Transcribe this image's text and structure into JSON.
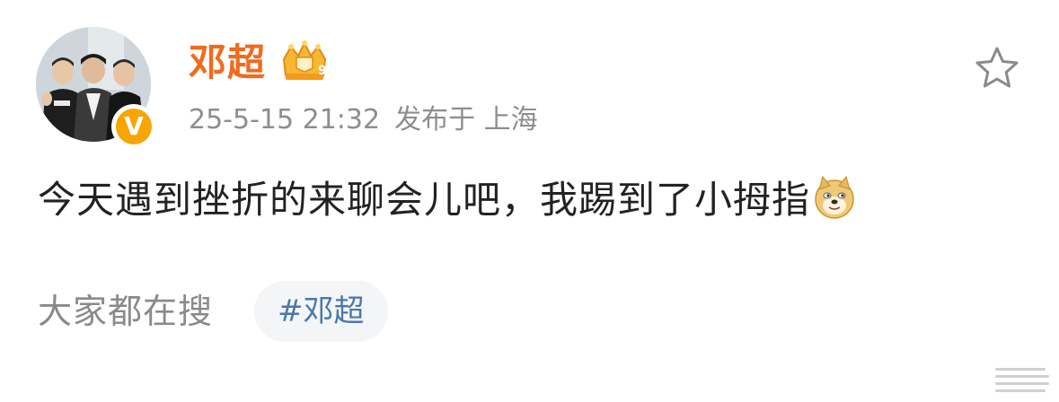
{
  "post": {
    "author": {
      "name": "邓超",
      "verified_badge_letter": "V",
      "verified_color": "#f7a500",
      "member_badge_icon": "crown-membership-icon",
      "member_level": "9"
    },
    "timestamp": "25-5-15 21:32",
    "location_text": "发布于 上海",
    "text": "今天遇到挫折的来聊会儿吧，我踢到了小拇指",
    "emoji_icon": "doge-emoji-icon"
  },
  "actions": {
    "favorite_icon": "star-outline-icon"
  },
  "trending": {
    "label": "大家都在搜",
    "topic": "#邓超"
  },
  "colors": {
    "username": "#f26a1b",
    "topic_link": "#4a78a8",
    "muted": "#8e8e8e"
  }
}
